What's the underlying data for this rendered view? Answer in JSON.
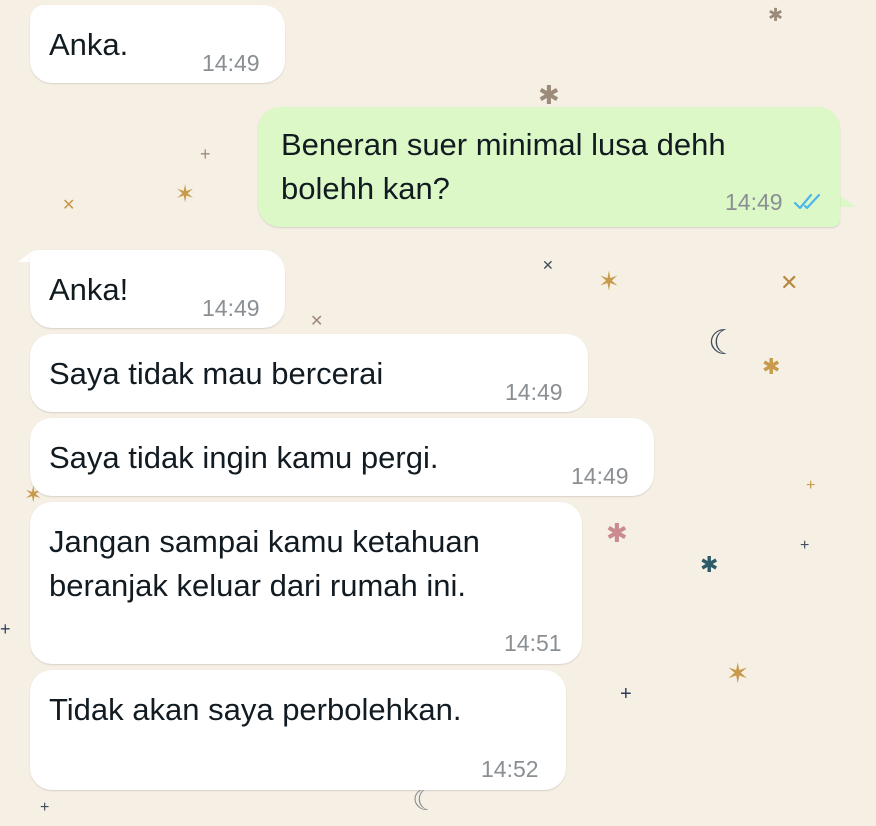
{
  "chat": {
    "messages": [
      {
        "text": "Anka.",
        "time": "14:49",
        "direction": "incoming"
      },
      {
        "text": "Beneran suer minimal lusa dehh\nbolehh kan?",
        "time": "14:49",
        "direction": "outgoing",
        "status": "read",
        "status_icon": "double-check-icon"
      },
      {
        "text": "Anka!",
        "time": "14:49",
        "direction": "incoming"
      },
      {
        "text": "Saya tidak mau bercerai",
        "time": "14:49",
        "direction": "incoming"
      },
      {
        "text": "Saya tidak ingin kamu pergi.",
        "time": "14:49",
        "direction": "incoming"
      },
      {
        "text": "Jangan sampai kamu ketahuan\nberanjak keluar dari rumah ini.",
        "time": "14:51",
        "direction": "incoming"
      },
      {
        "text": "Tidak akan saya perbolehkan.",
        "time": "14:52",
        "direction": "incoming"
      }
    ]
  },
  "colors": {
    "wallpaper": "#f6efe4",
    "incoming_bubble": "#ffffff",
    "outgoing_bubble": "#dcf8c6",
    "read_ticks": "#4fb6ec",
    "text": "#111b21",
    "timestamp": "#8a8f93"
  }
}
